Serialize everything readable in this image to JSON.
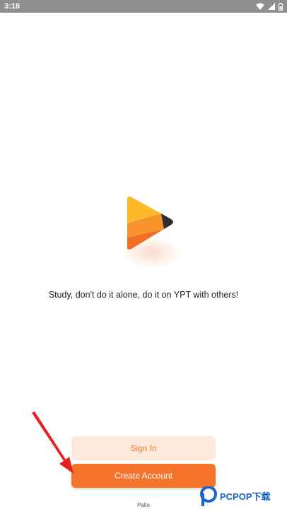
{
  "status_bar": {
    "time": "3:18",
    "icons": [
      "wifi-icon",
      "signal-icon",
      "battery-icon"
    ]
  },
  "logo": {
    "icon": "play-logo-icon",
    "colors": [
      "#fbb929",
      "#f8922a",
      "#f26d25",
      "#2f2f33"
    ]
  },
  "tagline": "Study, don't do it alone, do it on YPT with others!",
  "buttons": {
    "sign_in": "Sign In",
    "create_account": "Create Account"
  },
  "footer": "Pallo",
  "watermark": "PCPOP下载",
  "colors": {
    "accent": "#f5732a",
    "accent_light": "#fde9dc",
    "status_bar": "#8f8f8f",
    "arrow": "#e8201f"
  }
}
